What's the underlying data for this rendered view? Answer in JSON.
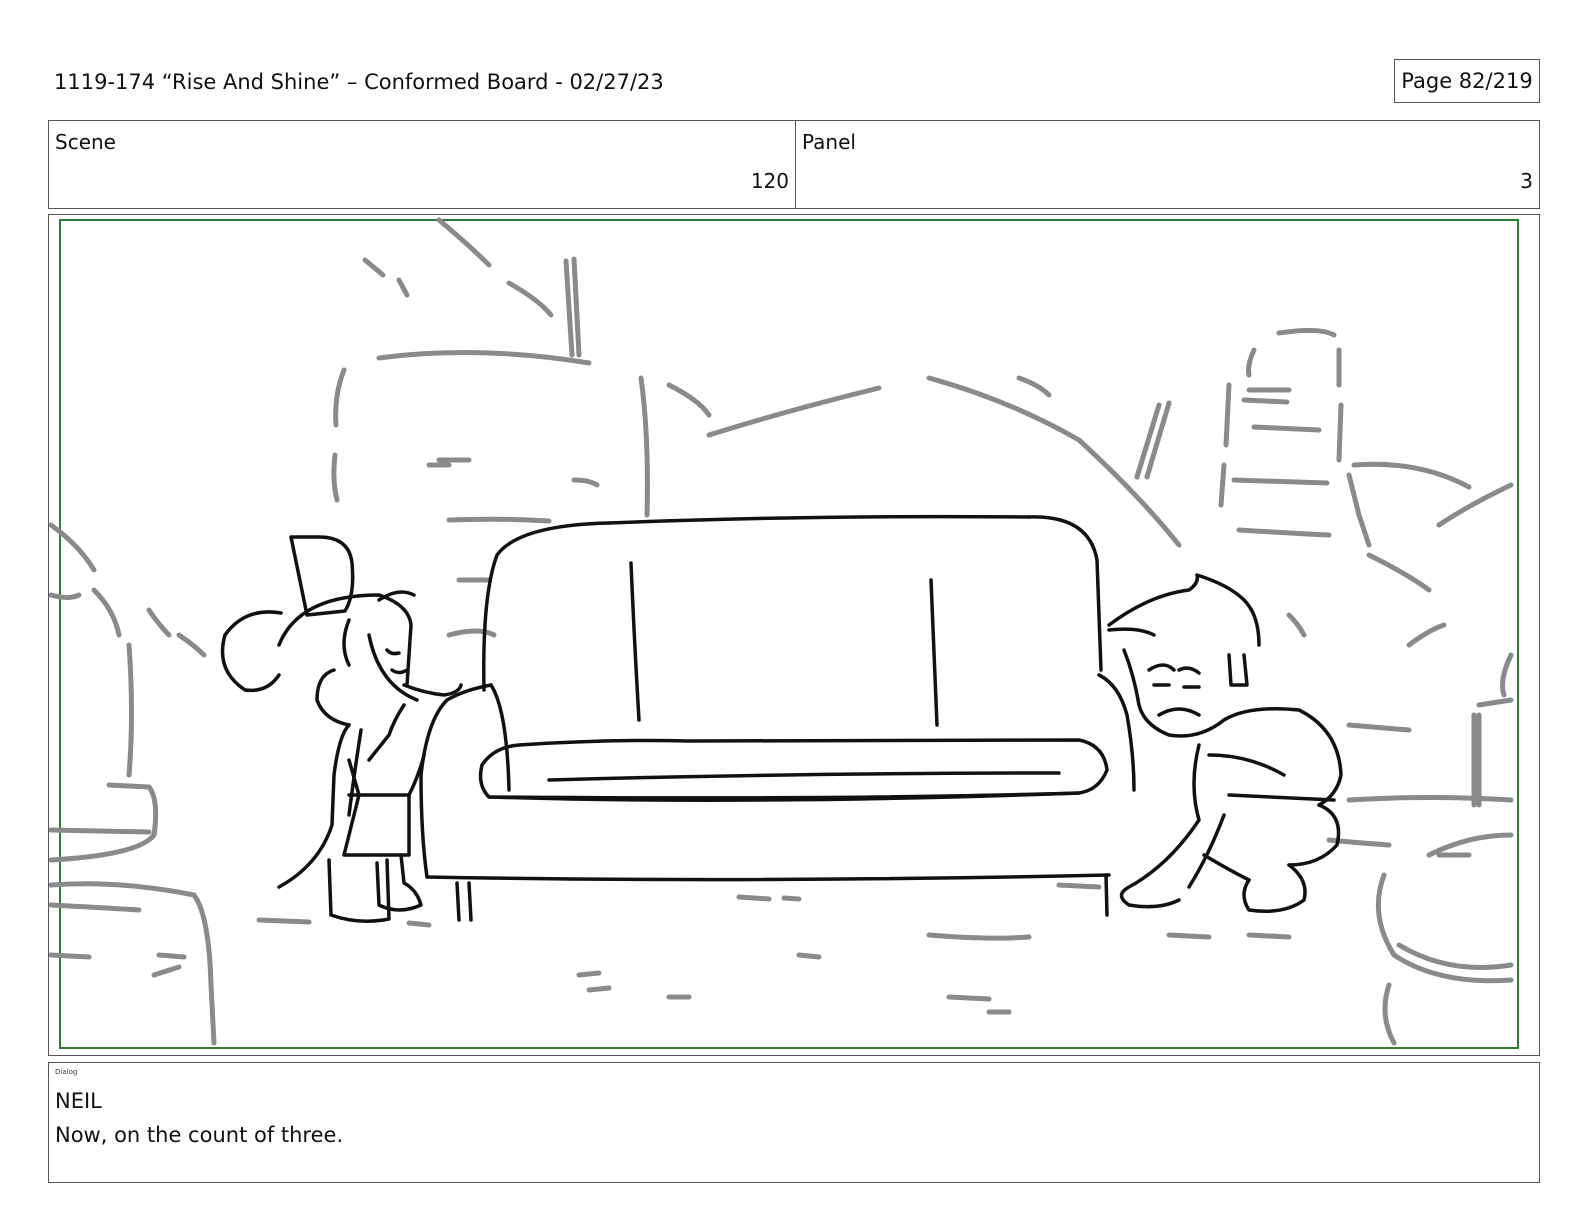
{
  "header": {
    "title": "1119-174 “Rise And Shine” – Conformed Board - 02/27/23",
    "page_label": "Page  82/219"
  },
  "info": {
    "scene_label": "Scene",
    "scene_value": "120",
    "panel_label": "Panel",
    "panel_value": "3"
  },
  "dialog": {
    "label": "Dialog",
    "speaker": "NEIL",
    "line": "Now, on the count of three."
  },
  "colors": {
    "safe_frame": "#2e7d32",
    "background_sketch": "#8a8a8a",
    "foreground_sketch": "#111111"
  }
}
